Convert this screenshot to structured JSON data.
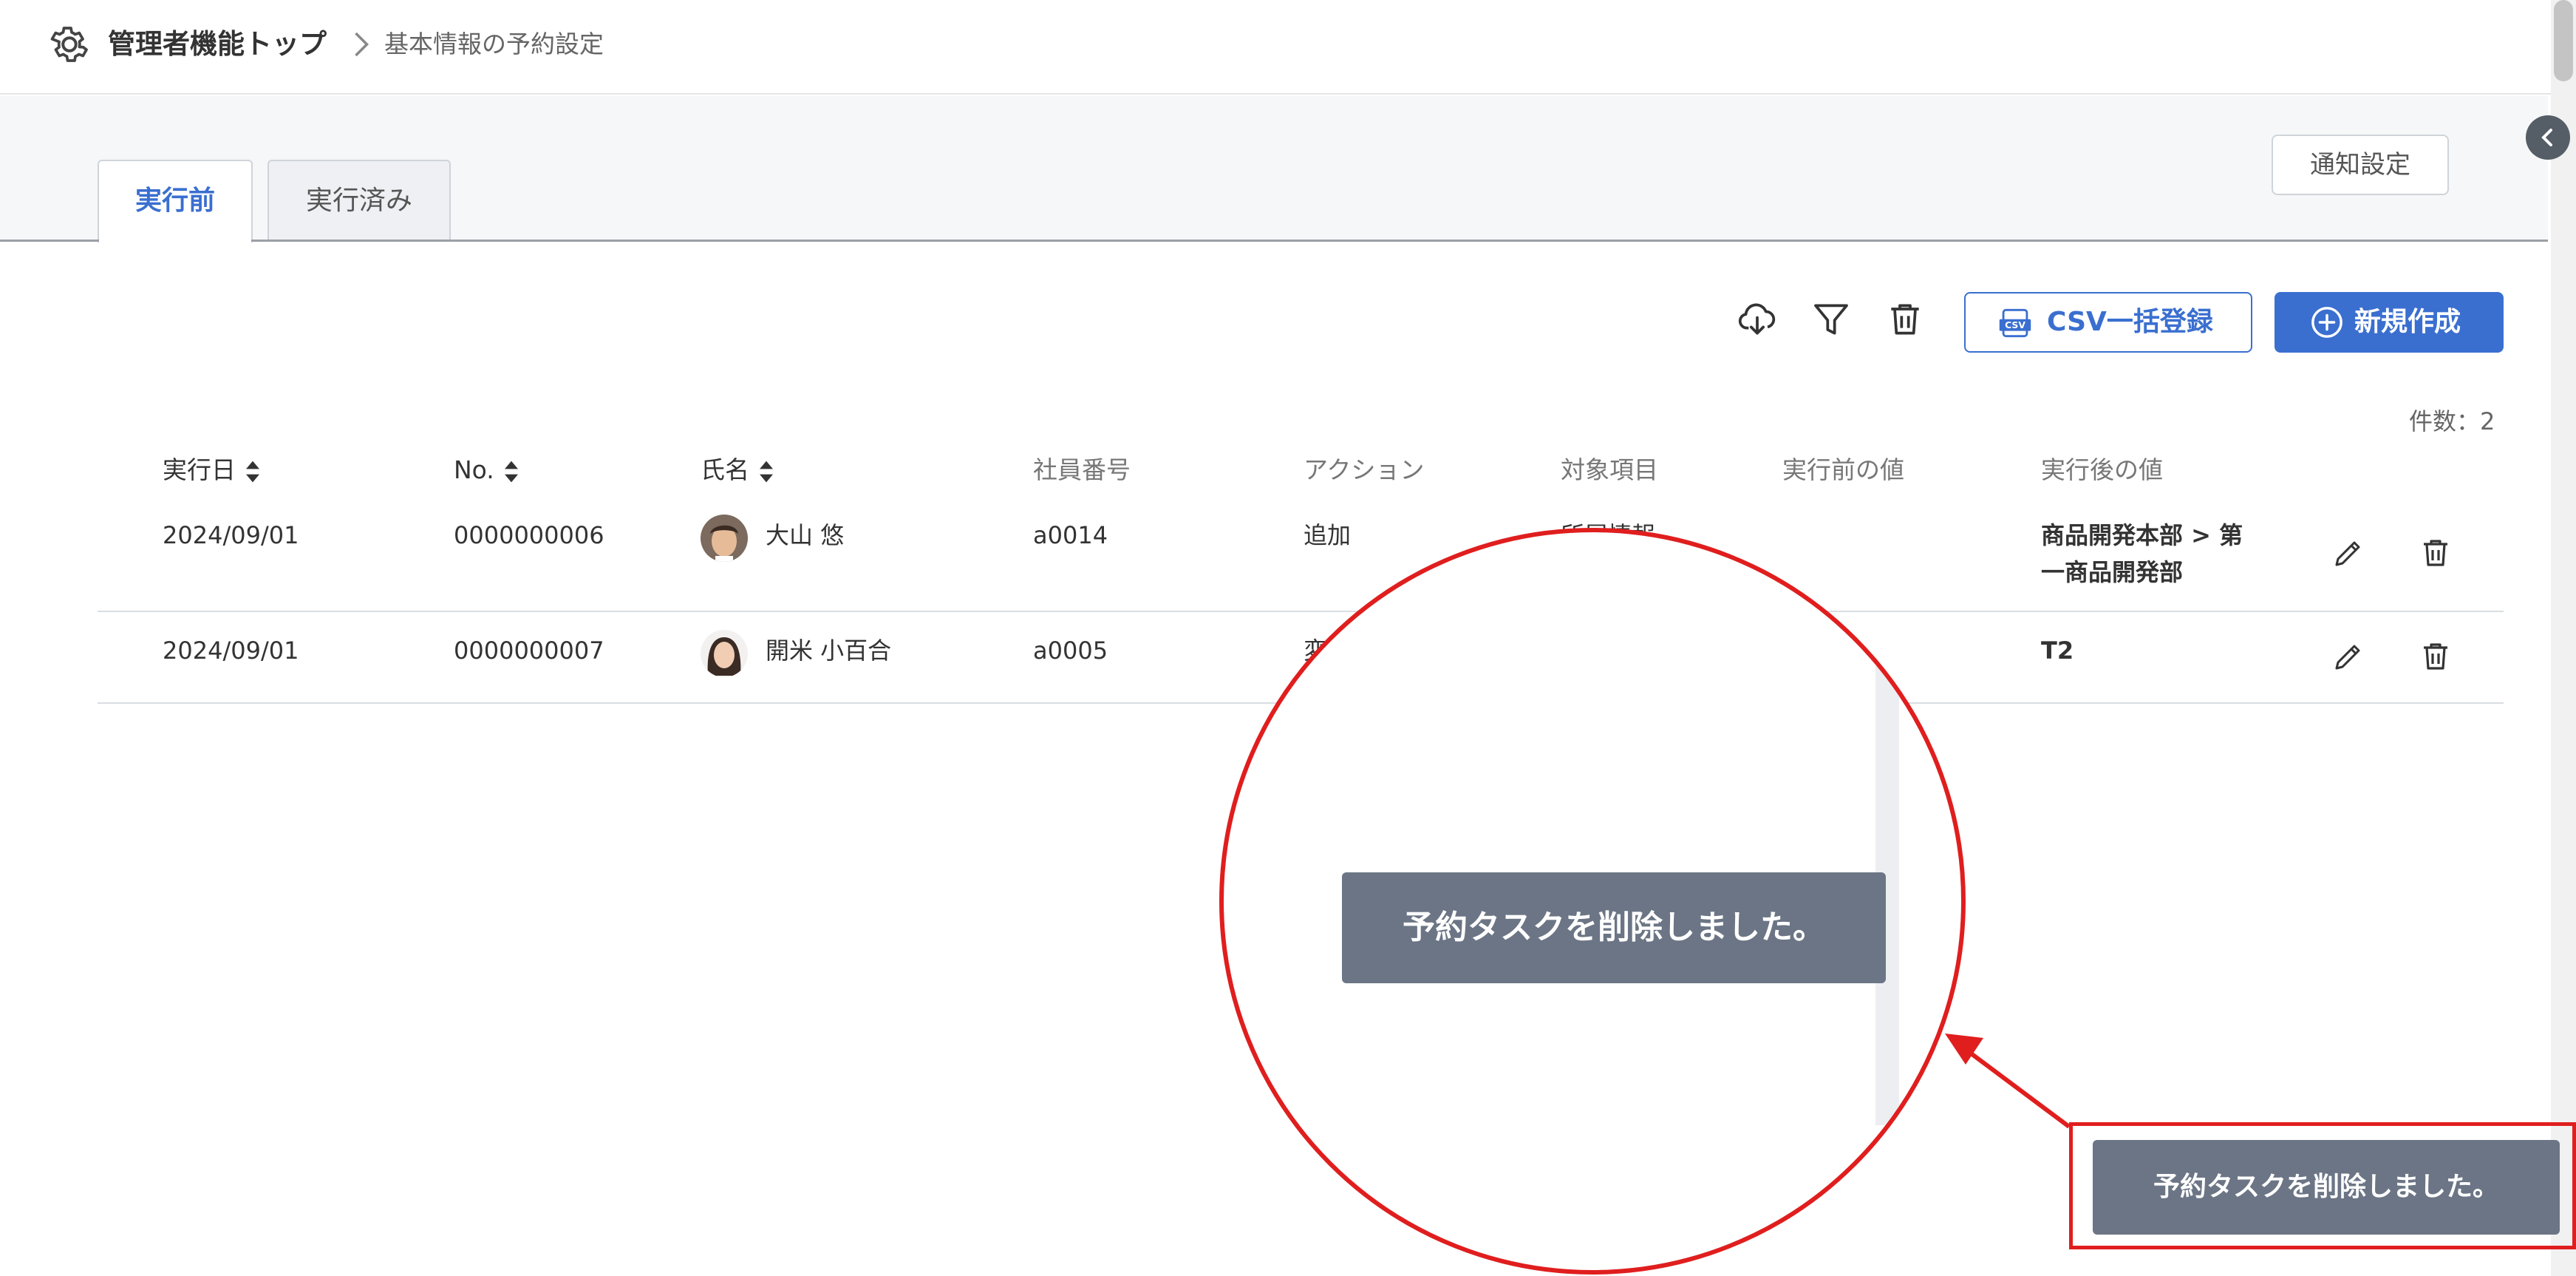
{
  "header": {
    "breadcrumb_top": "管理者機能トップ",
    "breadcrumb_current": "基本情報の予約設定"
  },
  "tabs": [
    {
      "label": "実行前",
      "active": true
    },
    {
      "label": "実行済み",
      "active": false
    }
  ],
  "toolbar": {
    "notify_label": "通知設定",
    "csv_label": "CSV一括登録",
    "new_label": "新規作成",
    "icons": [
      "cloud-download-icon",
      "filter-icon",
      "trash-icon"
    ]
  },
  "count_label": "件数：2",
  "table": {
    "headers": [
      "実行日",
      "No.",
      "氏名",
      "社員番号",
      "アクション",
      "対象項目",
      "実行前の値",
      "実行後の値"
    ],
    "rows": [
      {
        "date": "2024/09/01",
        "no": "0000000006",
        "name": "大山 悠",
        "employee_no": "a0014",
        "action": "追加",
        "target_partial": "所属情報",
        "before": "",
        "after_line1": "商品開発本部 > 第",
        "after_line2": "一商品開発部"
      },
      {
        "date": "2024/09/01",
        "no": "0000000007",
        "name": "開米 小百合",
        "employee_no": "a0005",
        "action_partial": "変",
        "before": "",
        "after": "T2"
      }
    ]
  },
  "toast": {
    "message": "予約タスクを削除しました。"
  },
  "colors": {
    "primary": "#3a6fd0",
    "toast_bg": "#6b7585",
    "highlight": "#e01e1e"
  }
}
